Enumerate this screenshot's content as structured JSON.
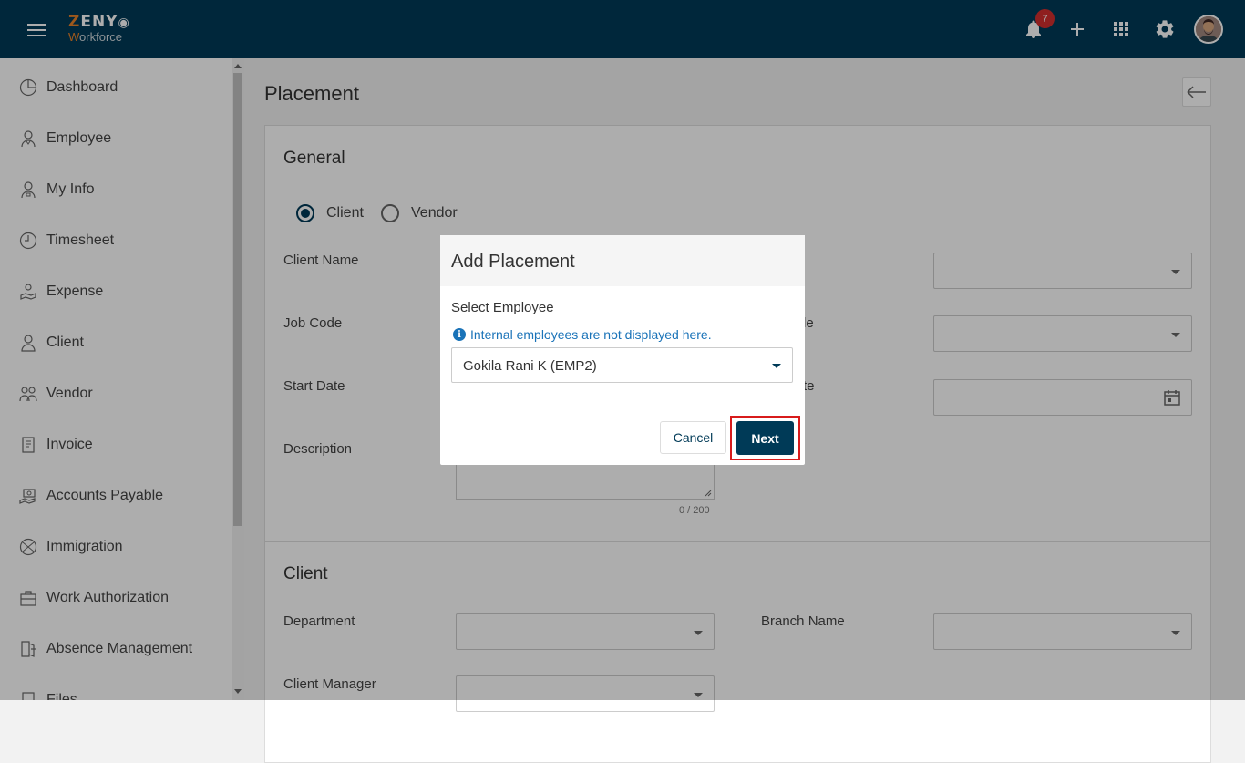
{
  "app": {
    "logo_top": "ZENY",
    "logo_bottom": "Workforce",
    "notification_count": "7"
  },
  "sidebar": {
    "items": [
      {
        "label": "Dashboard",
        "icon": "dashboard-icon"
      },
      {
        "label": "Employee",
        "icon": "employee-icon"
      },
      {
        "label": "My Info",
        "icon": "my-info-icon"
      },
      {
        "label": "Timesheet",
        "icon": "clock-icon"
      },
      {
        "label": "Expense",
        "icon": "expense-icon"
      },
      {
        "label": "Client",
        "icon": "person-icon"
      },
      {
        "label": "Vendor",
        "icon": "vendor-icon"
      },
      {
        "label": "Invoice",
        "icon": "invoice-icon"
      },
      {
        "label": "Accounts Payable",
        "icon": "accounts-payable-icon"
      },
      {
        "label": "Immigration",
        "icon": "globe-icon"
      },
      {
        "label": "Work Authorization",
        "icon": "briefcase-icon"
      },
      {
        "label": "Absence Management",
        "icon": "door-exit-icon"
      },
      {
        "label": "Files",
        "icon": "file-icon"
      }
    ]
  },
  "page": {
    "title": "Placement",
    "general": {
      "title": "General",
      "radio_client": "Client",
      "radio_vendor": "Vendor",
      "client_name_label": "Client Name",
      "job_code_label": "Job Code",
      "job_code_right_fragment": "le",
      "start_date_label": "Start Date",
      "end_date_fragment": "te",
      "description_label": "Description",
      "description_counter": "0 / 200"
    },
    "client": {
      "title": "Client",
      "department_label": "Department",
      "branch_name_label": "Branch Name",
      "client_manager_label": "Client Manager"
    }
  },
  "modal": {
    "title": "Add Placement",
    "select_label": "Select Employee",
    "info_text": "Internal employees are not displayed here.",
    "selected_employee": "Gokila Rani K (EMP2)",
    "cancel_label": "Cancel",
    "next_label": "Next"
  },
  "colors": {
    "topbar": "#003a57",
    "accent": "#e8822a",
    "info": "#1a73b8",
    "highlight": "#d81b1b"
  }
}
